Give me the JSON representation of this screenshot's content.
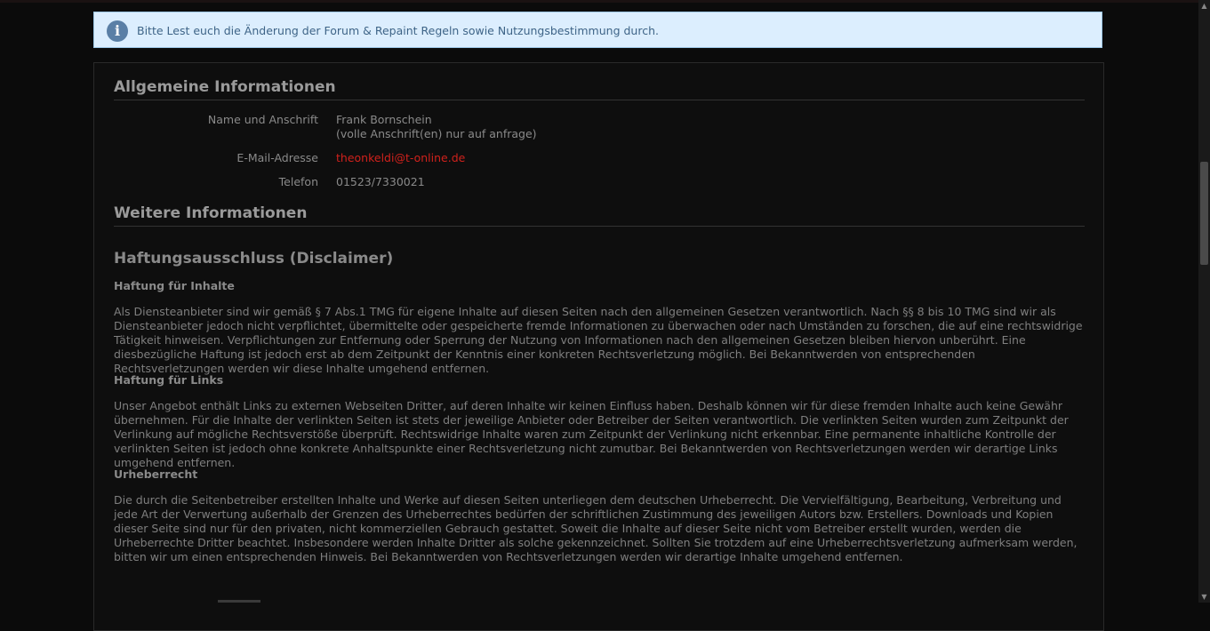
{
  "notice": {
    "icon": "info-icon",
    "text": "Bitte Lest euch die Änderung der Forum & Repaint Regeln sowie Nutzungsbestimmung durch."
  },
  "general": {
    "title": "Allgemeine Informationen",
    "name_label": "Name und Anschrift",
    "name_value": "Frank Bornschein",
    "address_note": "(volle Anschrift(en) nur auf anfrage)",
    "email_label": "E-Mail-Adresse",
    "email_value": "theonkeldi@t-online.de",
    "phone_label": "Telefon",
    "phone_value": "01523/7330021"
  },
  "further": {
    "title": "Weitere Informationen",
    "disclaimer_title": "Haftungsausschluss (Disclaimer)",
    "content_heading": "Haftung für Inhalte",
    "content_text": "Als Diensteanbieter sind wir gemäß § 7 Abs.1 TMG für eigene Inhalte auf diesen Seiten nach den allgemeinen Gesetzen verantwortlich. Nach §§ 8 bis 10 TMG sind wir als Diensteanbieter jedoch nicht verpflichtet, übermittelte oder gespeicherte fremde Informationen zu überwachen oder nach Umständen zu forschen, die auf eine rechtswidrige Tätigkeit hinweisen. Verpflichtungen zur Entfernung oder Sperrung der Nutzung von Informationen nach den allgemeinen Gesetzen bleiben hiervon unberührt. Eine diesbezügliche Haftung ist jedoch erst ab dem Zeitpunkt der Kenntnis einer konkreten Rechtsverletzung möglich. Bei Bekanntwerden von entsprechenden Rechtsverletzungen werden wir diese Inhalte umgehend entfernen.",
    "links_heading": "Haftung für Links",
    "links_text": "Unser Angebot enthält Links zu externen Webseiten Dritter, auf deren Inhalte wir keinen Einfluss haben. Deshalb können wir für diese fremden Inhalte auch keine Gewähr übernehmen. Für die Inhalte der verlinkten Seiten ist stets der jeweilige Anbieter oder Betreiber der Seiten verantwortlich. Die verlinkten Seiten wurden zum Zeitpunkt der Verlinkung auf mögliche Rechtsverstöße überprüft. Rechtswidrige Inhalte waren zum Zeitpunkt der Verlinkung nicht erkennbar. Eine permanente inhaltliche Kontrolle der verlinkten Seiten ist jedoch ohne konkrete Anhaltspunkte einer Rechtsverletzung nicht zumutbar. Bei Bekanntwerden von Rechtsverletzungen werden wir derartige Links umgehend entfernen.",
    "copyright_heading": "Urheberrecht",
    "copyright_text": "Die durch die Seitenbetreiber erstellten Inhalte und Werke auf diesen Seiten unterliegen dem deutschen Urheberrecht. Die Vervielfältigung, Bearbeitung, Verbreitung und jede Art der Verwertung außerhalb der Grenzen des Urheberrechtes bedürfen der schriftlichen Zustimmung des jeweiligen Autors bzw. Erstellers. Downloads und Kopien dieser Seite sind nur für den privaten, nicht kommerziellen Gebrauch gestattet. Soweit die Inhalte auf dieser Seite nicht vom Betreiber erstellt wurden, werden die Urheberrechte Dritter beachtet. Insbesondere werden Inhalte Dritter als solche gekennzeichnet. Sollten Sie trotzdem auf eine Urheberrechtsverletzung aufmerksam werden, bitten wir um einen entsprechenden Hinweis. Bei Bekanntwerden von Rechtsverletzungen werden wir derartige Inhalte umgehend entfernen."
  },
  "colors": {
    "link": "#d0211c",
    "notice_background": "#dceefe",
    "page_background": "#0b0b0b"
  }
}
